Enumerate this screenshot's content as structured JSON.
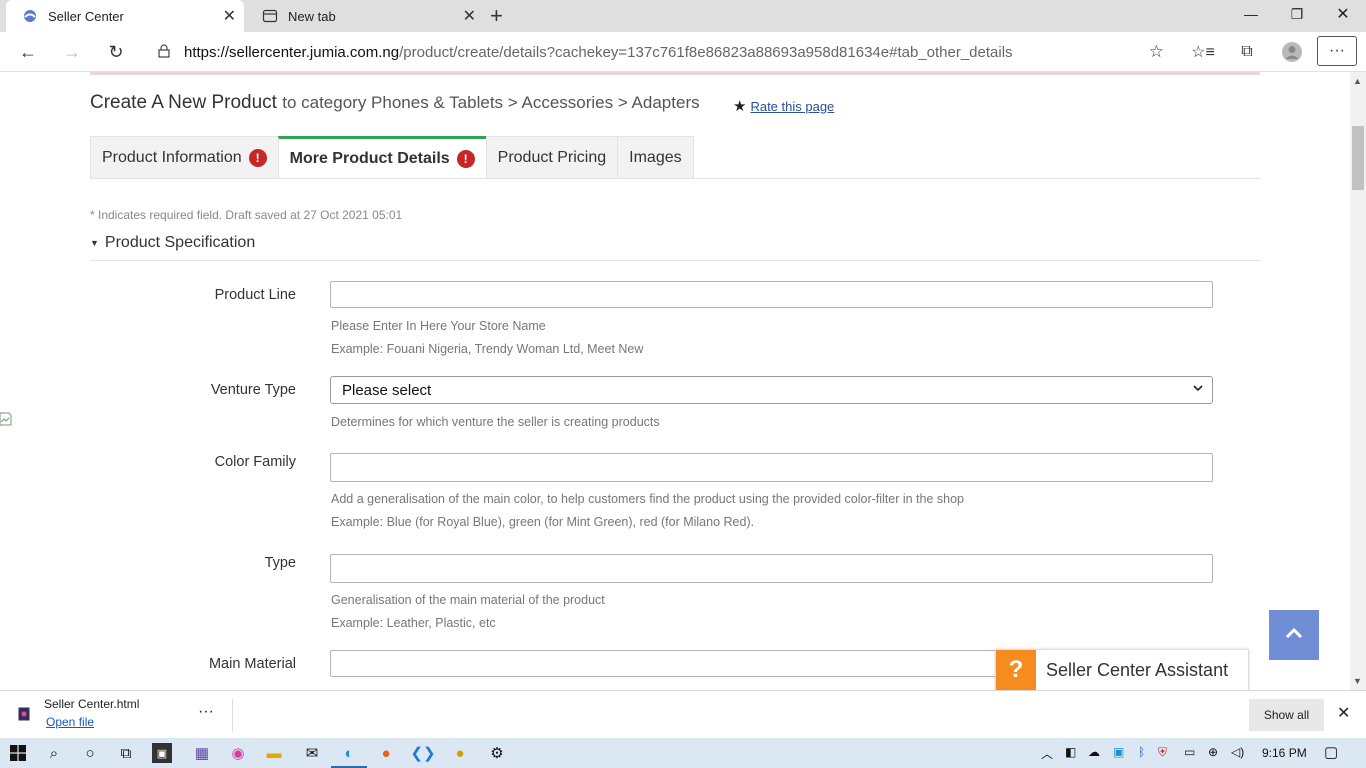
{
  "browser": {
    "tabs": [
      {
        "title": "Seller Center",
        "active": true
      },
      {
        "title": "New tab",
        "active": false
      }
    ],
    "url_host": "https://sellercenter.jumia.com.ng",
    "url_path": "/product/create/details?cachekey=137c761f8e86823a88693a958d81634e#tab_other_details"
  },
  "page": {
    "title": "Create A New Product",
    "category": "to category Phones & Tablets > Accessories > Adapters",
    "rate_link": "Rate this page",
    "tabs": [
      {
        "label": "Product Information",
        "warning": true
      },
      {
        "label": "More Product Details",
        "warning": true,
        "active": true
      },
      {
        "label": "Product Pricing",
        "warning": false
      },
      {
        "label": "Images",
        "warning": false
      }
    ],
    "required_note": "* Indicates required field. Draft saved at 27 Oct 2021 05:01",
    "section_title": "Product Specification",
    "fields": {
      "product_line": {
        "label": "Product Line",
        "value": "",
        "hint1": "Please Enter In Here Your Store Name",
        "hint2": "Example: Fouani Nigeria, Trendy Woman Ltd, Meet New"
      },
      "venture_type": {
        "label": "Venture Type",
        "selected": "Please select",
        "hint1": "Determines for which venture the seller is creating products"
      },
      "color_family": {
        "label": "Color Family",
        "value": "",
        "hint1": "Add a generalisation of the main color, to help customers find the product using the provided color-filter in the shop",
        "hint2": "Example: Blue (for Royal Blue), green (for Mint Green), red (for Milano Red)."
      },
      "type": {
        "label": "Type",
        "value": "",
        "hint1": "Generalisation of the main material of the product",
        "hint2": "Example: Leather, Plastic, etc"
      },
      "main_material": {
        "label": "Main Material",
        "value": ""
      }
    },
    "assistant": {
      "icon": "?",
      "label": "Seller Center Assistant"
    }
  },
  "downloads": {
    "file_name": "Seller Center.html",
    "open_link": "Open file",
    "show_all": "Show all"
  },
  "taskbar": {
    "clock": "9:16 PM"
  },
  "colors": {
    "active_tab_border": "#2ea44f",
    "warning": "#c62828",
    "assistant_orange": "#f68b1e",
    "scroll_top_button": "#6f8ed6",
    "link": "#2a4fa0"
  }
}
